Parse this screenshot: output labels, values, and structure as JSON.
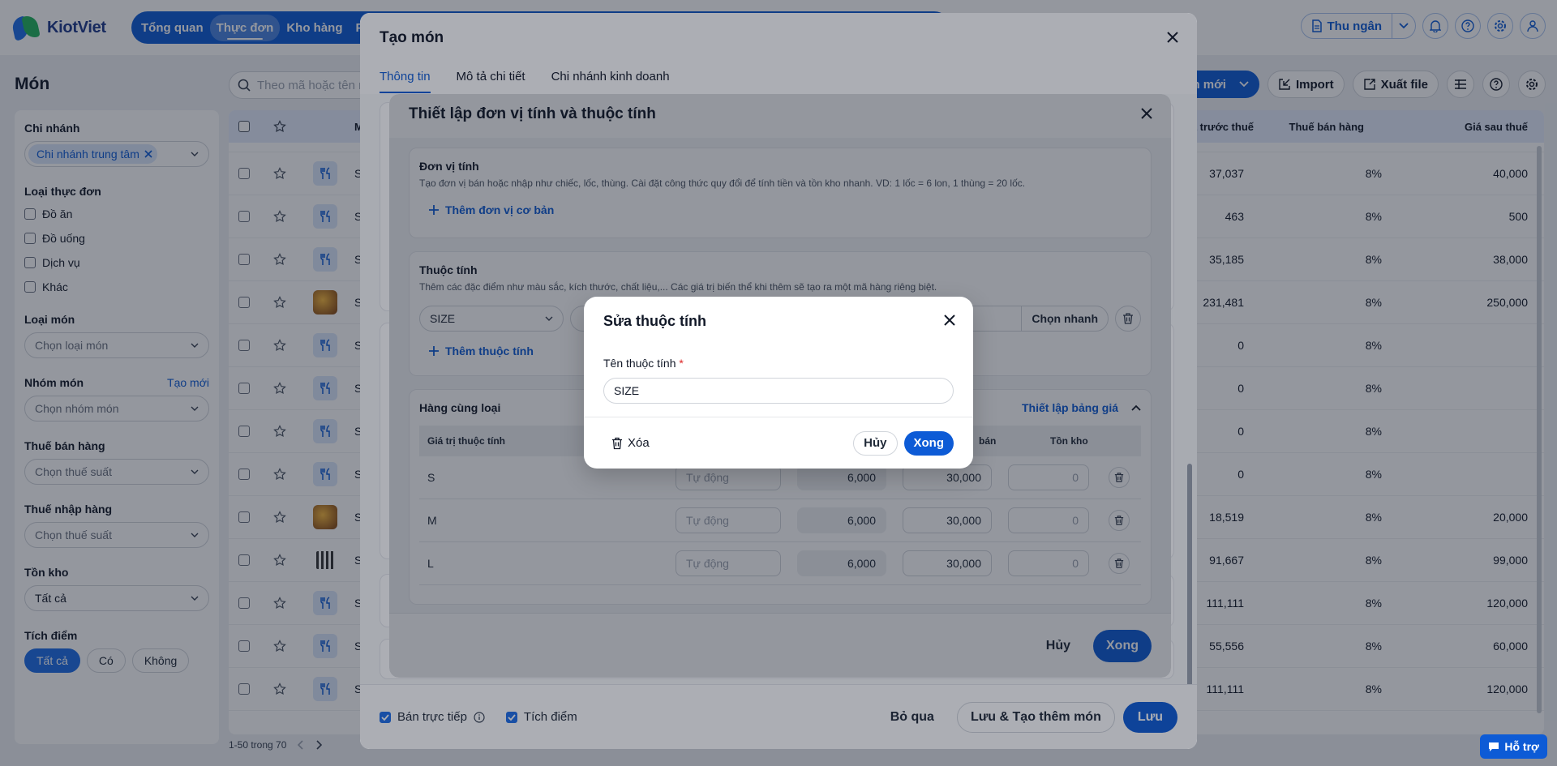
{
  "app": {
    "logo": "KiotViet"
  },
  "nav": {
    "items": [
      "Tổng quan",
      "Thực đơn",
      "Kho hàng",
      "Ph"
    ],
    "active": 1
  },
  "topbar": {
    "cashier": "Thu ngân"
  },
  "page": {
    "title": "Món",
    "search_placeholder": "Theo mã hoặc tên m"
  },
  "toolbar": {
    "new": "Món mới",
    "import": "Import",
    "export": "Xuất file"
  },
  "sidebar": {
    "branch": {
      "label": "Chi nhánh",
      "chip": "Chi nhánh trung tâm"
    },
    "menu_type": {
      "label": "Loại thực đơn",
      "options": [
        "Đồ ăn",
        "Đồ uống",
        "Dịch vụ",
        "Khác"
      ]
    },
    "dish_type": {
      "label": "Loại món",
      "placeholder": "Chọn loại món"
    },
    "dish_group": {
      "label": "Nhóm món",
      "link": "Tạo mới",
      "placeholder": "Chọn nhóm món"
    },
    "sales_tax": {
      "label": "Thuế bán hàng",
      "placeholder": "Chọn thuế suất"
    },
    "import_tax": {
      "label": "Thuế nhập hàng",
      "placeholder": "Chọn thuế suất"
    },
    "stock": {
      "label": "Tồn kho",
      "value": "Tất cả"
    },
    "points": {
      "label": "Tích điểm",
      "options": [
        "Tất cả",
        "Có",
        "Không"
      ],
      "active": 0
    }
  },
  "table": {
    "headers": {
      "code": "M",
      "pre": "Giá trước thuế",
      "tax": "Thuế bán hàng",
      "post": "Giá sau thuế"
    },
    "rows": [
      {
        "code": "S",
        "img": "fork",
        "pre": "37,037",
        "tax": "8%",
        "post": "40,000"
      },
      {
        "code": "S",
        "img": "fork",
        "pre": "463",
        "tax": "8%",
        "post": "500"
      },
      {
        "code": "S",
        "img": "fork",
        "pre": "35,185",
        "tax": "8%",
        "post": "38,000"
      },
      {
        "code": "S",
        "img": "photo",
        "pre": "231,481",
        "tax": "8%",
        "post": "250,000"
      },
      {
        "code": "S",
        "img": "fork",
        "pre": "0",
        "tax": "8%",
        "post": ""
      },
      {
        "code": "S",
        "img": "fork",
        "pre": "0",
        "tax": "8%",
        "post": ""
      },
      {
        "code": "S",
        "img": "fork",
        "pre": "0",
        "tax": "8%",
        "post": ""
      },
      {
        "code": "S",
        "img": "fork",
        "pre": "0",
        "tax": "8%",
        "post": ""
      },
      {
        "code": "S",
        "img": "photo",
        "pre": "18,519",
        "tax": "8%",
        "post": "20,000"
      },
      {
        "code": "S",
        "img": "qr",
        "pre": "91,667",
        "tax": "8%",
        "post": "99,000"
      },
      {
        "code": "S",
        "img": "fork",
        "pre": "111,111",
        "tax": "8%",
        "post": "120,000"
      },
      {
        "code": "S",
        "img": "fork",
        "pre": "55,556",
        "tax": "8%",
        "post": "60,000"
      },
      {
        "code": "S",
        "img": "fork",
        "pre": "111,111",
        "tax": "8%",
        "post": "120,000"
      }
    ],
    "pager": "1-50 trong 70"
  },
  "create_modal": {
    "title": "Tạo món",
    "tabs": [
      "Thông tin",
      "Mô tả chi tiết",
      "Chi nhánh kinh doanh"
    ],
    "active_tab": 0,
    "footer": {
      "direct_sale": "Bán trực tiếp",
      "points": "Tích điểm",
      "skip": "Bỏ qua",
      "save_more": "Lưu & Tạo thêm món",
      "save": "Lưu"
    }
  },
  "unit_modal": {
    "title": "Thiết lập đơn vị tính và thuộc tính",
    "unit": {
      "title": "Đơn vị tính",
      "desc": "Tạo đơn vị bán hoặc nhập như chiếc, lốc, thùng. Cài đặt công thức quy đổi để tính tiền và tồn kho nhanh. VD: 1 lốc = 6 lon, 1 thùng = 20 lốc.",
      "add": "Thêm đơn vị cơ bản"
    },
    "attribute": {
      "title": "Thuộc tính",
      "desc": "Thêm các đặc điểm như màu sắc, kích thước, chất liệu,... Các giá trị biến thể khi thêm sẽ tạo ra một mã hàng riêng biệt.",
      "selected": "SIZE",
      "quick": "Chọn nhanh",
      "add": "Thêm thuộc tính"
    },
    "variants": {
      "title": "Hàng cùng loại",
      "price_link": "Thiết lập bảng giá",
      "headers": {
        "value": "Giá trị thuộc tính",
        "sale": "bán",
        "stock": "Tồn kho"
      },
      "rows": [
        {
          "value": "S",
          "code": "Tự động",
          "cost": "6,000",
          "price": "30,000",
          "stock": "0"
        },
        {
          "value": "M",
          "code": "Tự động",
          "cost": "6,000",
          "price": "30,000",
          "stock": "0"
        },
        {
          "value": "L",
          "code": "Tự động",
          "cost": "6,000",
          "price": "30,000",
          "stock": "0"
        }
      ]
    },
    "footer": {
      "cancel": "Hủy",
      "done": "Xong"
    }
  },
  "edit_modal": {
    "title": "Sửa thuộc tính",
    "label": "Tên thuộc tính",
    "required": "*",
    "value": "SIZE",
    "delete": "Xóa",
    "cancel": "Hủy",
    "done": "Xong"
  },
  "support": "Hỗ trợ",
  "colors": {
    "primary": "#0d5bd6",
    "bg": "#eef1f5",
    "danger": "#dc2626"
  }
}
